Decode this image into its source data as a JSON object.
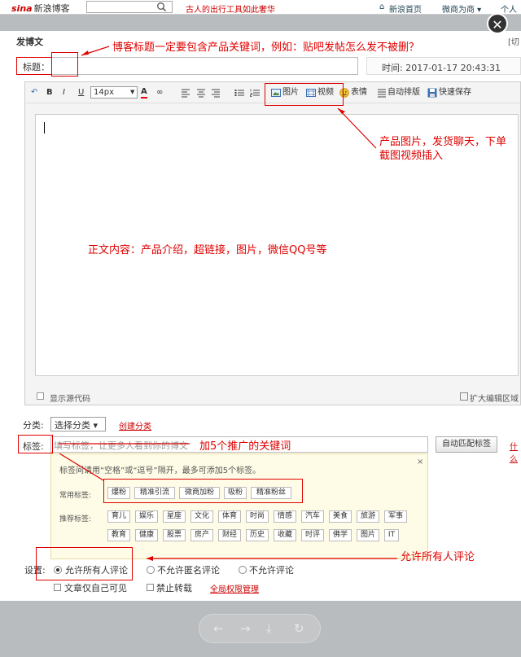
{
  "topbar": {
    "logo": "sina",
    "logo_cn": "新浪博客",
    "search_placeholder": "",
    "promo": "古人的出行工具如此奢华",
    "links": [
      "新浪首页",
      "微商为商 ▾",
      "个人"
    ]
  },
  "dialog": {
    "title": "发博文",
    "switch_label": "[切",
    "close_symbol": "✕"
  },
  "title_row": {
    "label": "标题：",
    "value": "",
    "time_label": "时间:",
    "time_value": "2017-01-17 20:43:31"
  },
  "toolbar": {
    "font_size": "14px",
    "image_label": "图片",
    "video_label": "视频",
    "emoji_label": "表情",
    "autoformat_label": "自动排版",
    "quicksave_label": "快速保存"
  },
  "editor": {
    "show_source_label": "显示源代码",
    "expand_label": "扩大编辑区域"
  },
  "category": {
    "label": "分类:",
    "selected": "选择分类 ▾",
    "create_link": "创建分类"
  },
  "tags": {
    "label": "标签:",
    "placeholder": "填写标签，让更多人看到你的博文",
    "auto_button": "自动匹配标签",
    "more_link": "什么",
    "hint": "标签间请用“空格”或“逗号”隔开，最多可添加5个标签。",
    "close": "×",
    "common_label": "常用标签:",
    "common": [
      "爆粉",
      "精准引流",
      "微商加粉",
      "吸粉",
      "精准粉丝"
    ],
    "recommended_label": "推荐标签:",
    "recommended_row1": [
      "育儿",
      "娱乐",
      "星座",
      "文化",
      "体育",
      "时尚",
      "情感",
      "汽车",
      "美食",
      "旅游",
      "军事"
    ],
    "recommended_row2": [
      "教育",
      "健康",
      "股票",
      "房产",
      "财经",
      "历史",
      "收藏",
      "时评",
      "佛学",
      "图片",
      "IT"
    ]
  },
  "settings": {
    "label": "设置:",
    "comments": [
      "允许所有人评论",
      "不允许匿名评论",
      "不允许评论"
    ],
    "private_label": "文章仅自己可见",
    "no_repost_label": "禁止转载",
    "privacy_link": "全局权限管理"
  },
  "nav": [
    "←",
    "→",
    "⤓",
    "↻"
  ],
  "annotations": {
    "title_note": "博客标题一定要包含产品关键词，例如：贴吧发帖怎么发不被删？",
    "media_note_1": "产品图片，发货聊天，下单",
    "media_note_2": "截图视频插入",
    "body_note": "正文内容：产品介绍，超链接，图片，微信QQ号等",
    "tags_note": "加5个推广的关键词",
    "comment_note": "允许所有人评论"
  },
  "colors": {
    "annotation_red": "#e00000",
    "link_red": "#c00000"
  }
}
